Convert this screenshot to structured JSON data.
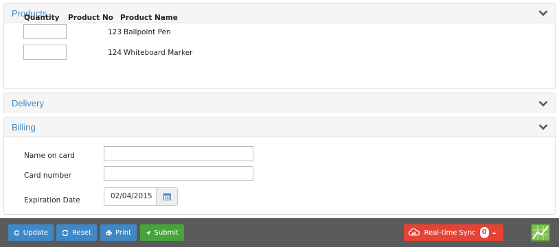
{
  "products": {
    "title": "Products",
    "headers": {
      "quantity": "Quantity",
      "product_no": "Product No",
      "product_name": "Product Name"
    },
    "rows": [
      {
        "quantity": "",
        "product_no": "123",
        "product_name": "Ballpoint Pen"
      },
      {
        "quantity": "",
        "product_no": "124",
        "product_name": "Whiteboard Marker"
      }
    ]
  },
  "delivery": {
    "title": "Delivery"
  },
  "billing": {
    "title": "Billing",
    "name_on_card_label": "Name on card",
    "name_on_card_value": "",
    "card_number_label": "Card number",
    "card_number_value": "",
    "expiration_label": "Expiration Date",
    "expiration_value": "02/04/2015"
  },
  "toolbar": {
    "update_label": "Update",
    "reset_label": "Reset",
    "print_label": "Print",
    "submit_label": "Submit",
    "sync_label": "Real-time Sync",
    "sync_count": "0"
  },
  "icons": {
    "collapse": "chevron-down-icon",
    "calendar": "calendar-icon",
    "update": "refresh-icon",
    "reset": "reset-icon",
    "print": "print-icon",
    "submit": "send-icon",
    "sync": "cloud-sync-icon"
  },
  "colors": {
    "accent_blue": "#3f88c8",
    "submit_green": "#46a53a",
    "sync_red": "#e64335",
    "toolbar_bg": "#5a5a5a",
    "panel_title": "#3f87c7"
  }
}
